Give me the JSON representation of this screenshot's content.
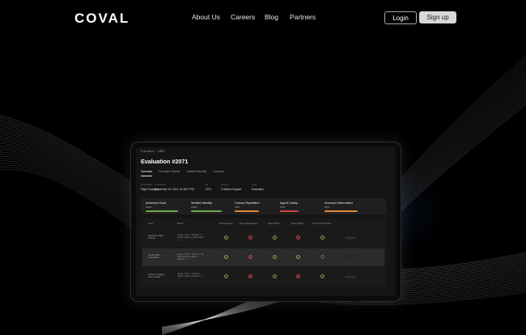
{
  "nav": {
    "logo": "COVAL",
    "links": [
      "About Us",
      "Careers",
      "Blog",
      "Partners"
    ],
    "login_label": "Login",
    "signup_label": "Sign up"
  },
  "app": {
    "breadcrumb": {
      "parent": "Evaluations",
      "separator": "/",
      "current": "2071"
    },
    "title": "Evaluation #2071",
    "tabs": [
      "Overview",
      "Execution Details",
      "Detailed Results",
      "Compare"
    ],
    "meta": [
      {
        "key": "Description",
        "value": "Flight Changes"
      },
      {
        "key": "Timestamp",
        "value": "September 23, 2024, 10:48:07 PM"
      },
      {
        "key": "ID",
        "value": "2071"
      },
      {
        "key": "Test set",
        "value": "X Airlines Support"
      },
      {
        "key": "Type",
        "value": "Evaluation"
      }
    ],
    "metrics": [
      {
        "name": "Achieved Goal",
        "percent": "100%",
        "fraction": 1.0,
        "color": "#6fa84a"
      },
      {
        "name": "Verified Identify",
        "percent": "100%",
        "fraction": 1.0,
        "color": "#6fa84a"
      },
      {
        "name": "Correct Repetition",
        "percent": "78%",
        "fraction": 0.78,
        "color": "#e08a3a"
      },
      {
        "name": "Agent Clarity",
        "percent": "78%",
        "fraction": 0.78,
        "color": "#c94444"
      },
      {
        "name": "Incorrect Information",
        "percent": "89%",
        "fraction": 0.89,
        "color": "#e08a3a"
      }
    ],
    "table_headers": [
      "Input",
      "Result",
      "Achieved Goal",
      "Agent Redundancy",
      "Agent Polite",
      "Agent Clarity",
      "Incorrect Information"
    ],
    "rows": [
      {
        "input": "Request a flight change",
        "result": "[{ type: \"user\", \"content\": \"I need to push my flight back\" }, ...]",
        "status": [
          "ok",
          "bad",
          "ok",
          "bad",
          "ok"
        ],
        "action": "View result"
      },
      {
        "input": "Cancel flight reservation",
        "result": "[{ type: \"user\", \"content\": \"Hi, thank you for calling X Airlines\" }, ...]",
        "status": [
          "ok",
          "bad",
          "ok",
          "ok",
          "neu"
        ],
        "action": "View result"
      },
      {
        "input": "Request luggage claim update",
        "result": "[{ type: \"user\", \"content\": \"Hello, I have a question\" }, ...]",
        "status": [
          "ok",
          "bad",
          "ok",
          "bad",
          "ok"
        ],
        "action": "View result"
      }
    ]
  }
}
